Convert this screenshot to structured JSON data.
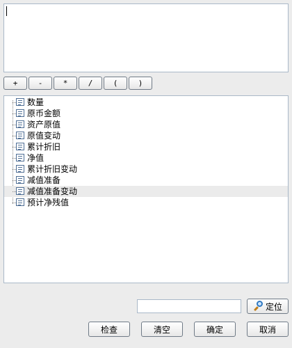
{
  "formula": {
    "value": ""
  },
  "operators": [
    "+",
    "-",
    "*",
    "/",
    "(",
    ")"
  ],
  "tree": {
    "items": [
      {
        "label": "数量"
      },
      {
        "label": "原币金额"
      },
      {
        "label": "资产原值"
      },
      {
        "label": "原值变动"
      },
      {
        "label": "累计折旧"
      },
      {
        "label": "净值"
      },
      {
        "label": "累计折旧变动"
      },
      {
        "label": "减值准备"
      },
      {
        "label": "减值准备变动"
      },
      {
        "label": "预计净残值"
      }
    ],
    "highlighted_item": "减值准备变动"
  },
  "search": {
    "value": "",
    "locate_label": "定位"
  },
  "buttons": {
    "check": "检查",
    "clear": "清空",
    "ok": "确定",
    "cancel": "取消"
  },
  "icons": {
    "tree_item": "list-item-icon",
    "locate": "magnifier-icon"
  }
}
